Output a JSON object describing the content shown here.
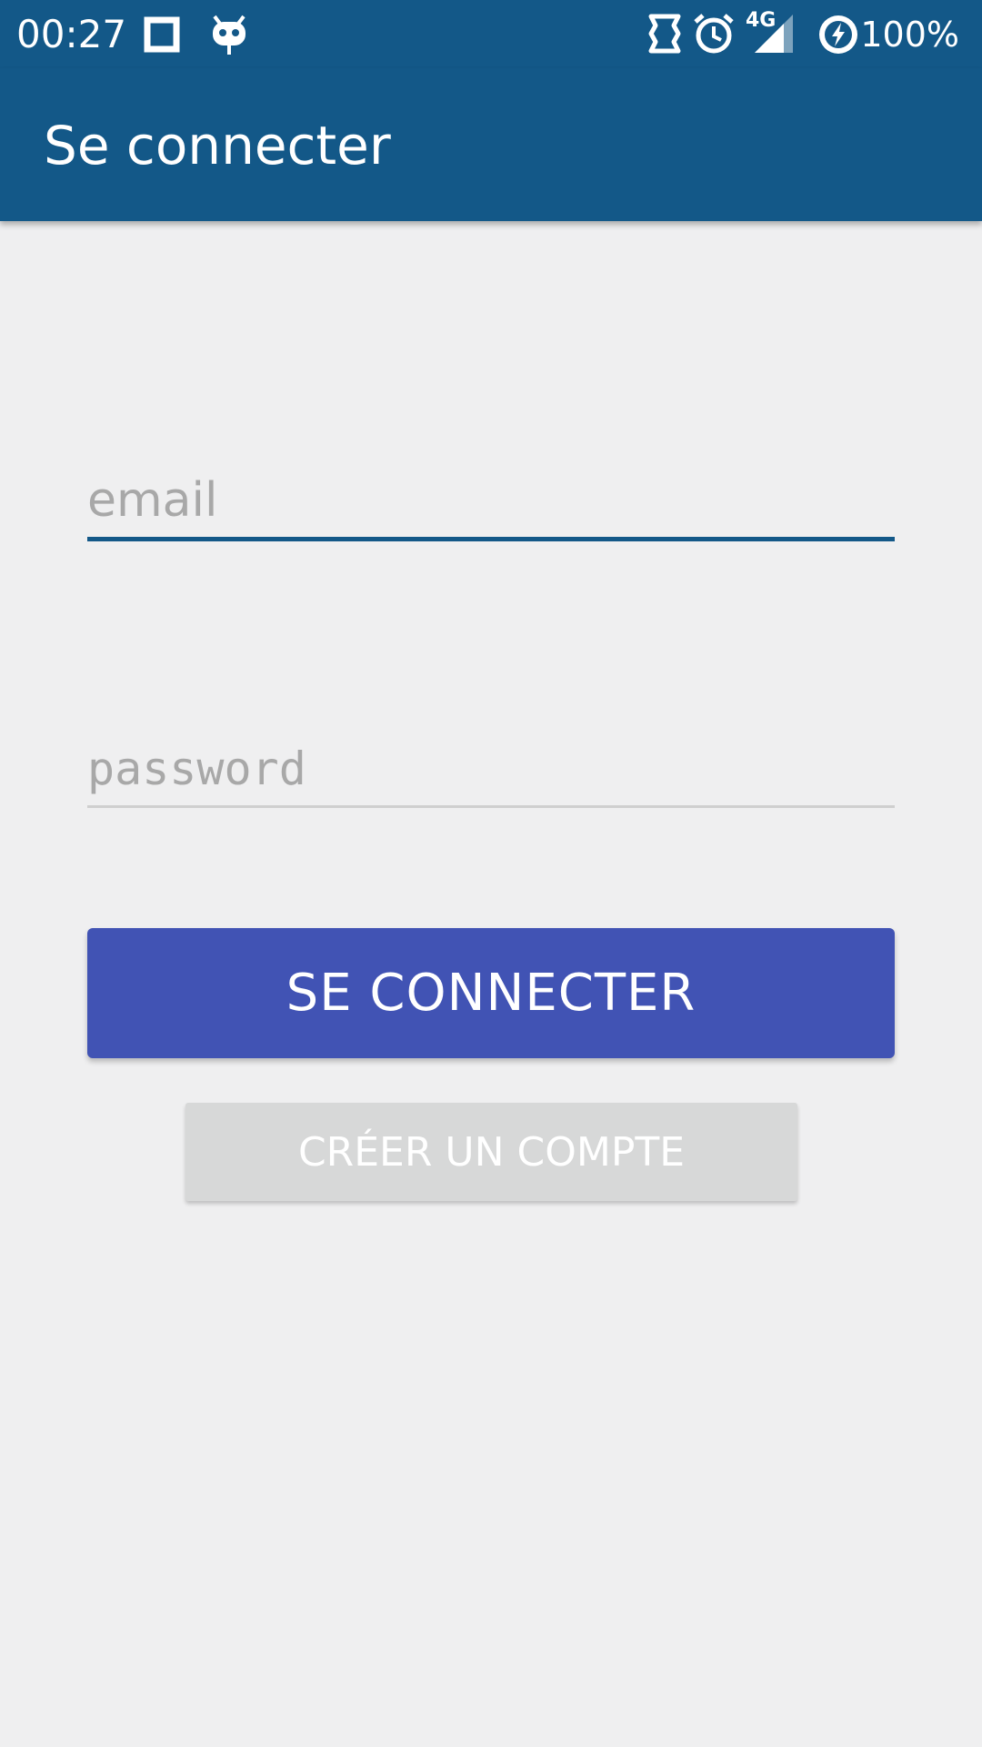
{
  "status_bar": {
    "time": "00:27",
    "network_type": "4G",
    "battery_percent": "100%",
    "icons": [
      "square-icon",
      "cyanogen-mascot-icon",
      "vibrate-icon",
      "alarm-icon",
      "signal-icon",
      "battery-charging-icon"
    ]
  },
  "app_bar": {
    "title": "Se connecter"
  },
  "form": {
    "email_placeholder": "email",
    "password_placeholder": "password",
    "login_button_label": "SE CONNECTER",
    "create_account_label": "CRÉER UN COMPTE"
  },
  "colors": {
    "primary": "#135888",
    "button_accent": "#4153b4",
    "background": "#efeff0",
    "secondary_button": "#d7d8d8"
  }
}
